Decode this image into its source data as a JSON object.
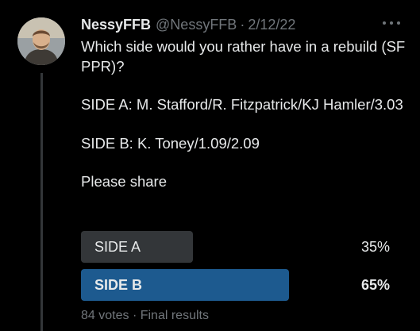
{
  "author": {
    "display_name": "NessyFFB",
    "handle": "@NessyFFB",
    "separator": "·",
    "date": "2/12/22"
  },
  "tweet": {
    "lines": [
      "Which side would you rather have in a rebuild (SF PPR)?",
      "SIDE A: M. Stafford/R. Fitzpatrick/KJ Hamler/3.03",
      "SIDE B: K. Toney/1.09/2.09",
      "Please share"
    ]
  },
  "poll": {
    "options": [
      {
        "label": "SIDE A",
        "percent_text": "35%",
        "percent": 35,
        "winner": false
      },
      {
        "label": "SIDE B",
        "percent_text": "65%",
        "percent": 65,
        "winner": true
      }
    ],
    "votes_text": "84 votes",
    "separator": "·",
    "status_text": "Final results"
  },
  "colors": {
    "background": "#000000",
    "text": "#e7e9ea",
    "muted": "#71767b",
    "bar_loser": "#333639",
    "bar_winner": "#1d5a8f"
  }
}
